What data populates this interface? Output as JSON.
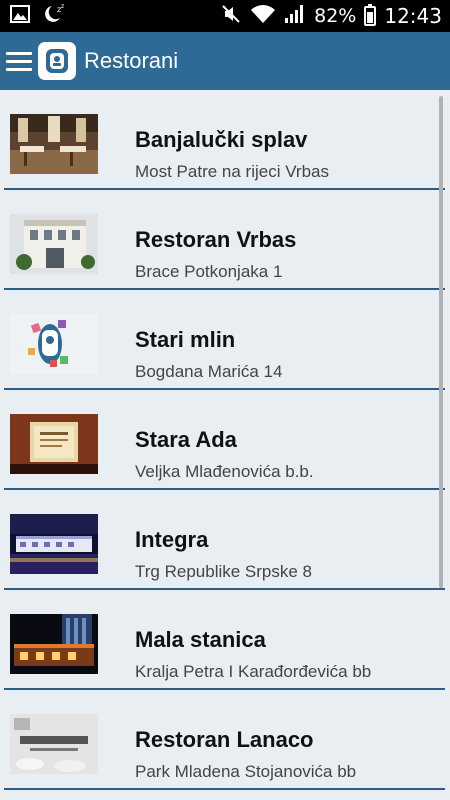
{
  "status_bar": {
    "battery": "82%",
    "battery_level": 0.82,
    "time": "12:43",
    "icons": [
      "image-icon",
      "sleep-moon-icon",
      "mute-icon",
      "wifi-icon",
      "signal-icon",
      "battery-icon"
    ]
  },
  "app_bar": {
    "title": "Restorani",
    "color": "#2e6a96"
  },
  "restaurants": [
    {
      "name": "Banjalučki splav",
      "address": "Most Patre na rijeci Vrbas"
    },
    {
      "name": "Restoran Vrbas",
      "address": "Brace Potkonjaka 1"
    },
    {
      "name": "Stari mlin",
      "address": "Bogdana Marića 14"
    },
    {
      "name": "Stara Ada",
      "address": "Veljka Mlađenovića b.b."
    },
    {
      "name": "Integra",
      "address": "Trg Republike Srpske 8"
    },
    {
      "name": "Mala stanica",
      "address": "Kralja Petra I Karađorđevića bb"
    },
    {
      "name": "Restoran Lanaco",
      "address": "Park Mladena Stojanovića bb"
    }
  ],
  "divider_color": "#2d5f84"
}
